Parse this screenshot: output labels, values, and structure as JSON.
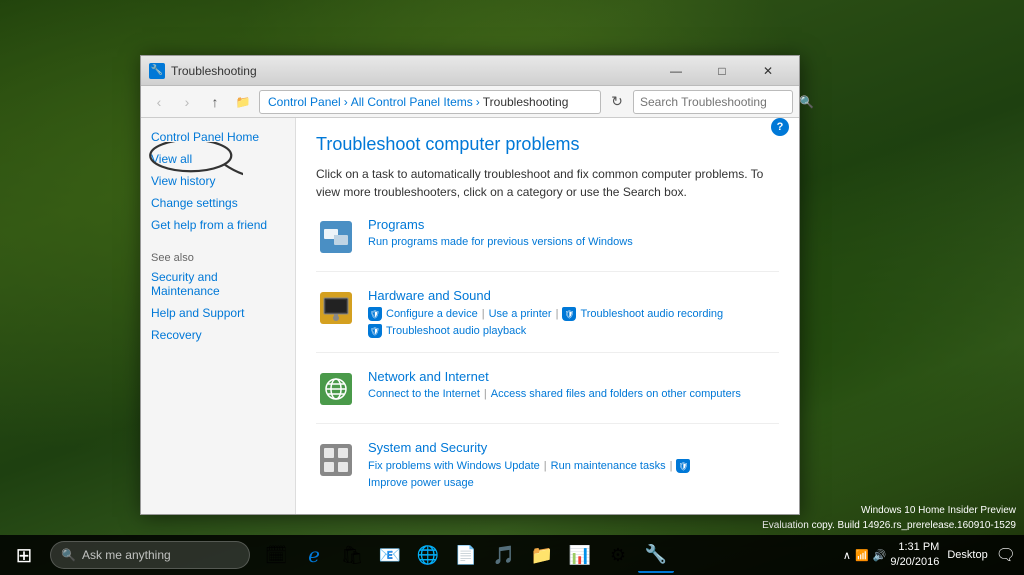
{
  "desktop": {
    "background": "forest"
  },
  "window": {
    "title": "Troubleshooting",
    "icon": "🔧",
    "controls": {
      "minimize": "—",
      "maximize": "□",
      "close": "✕"
    },
    "addressBar": {
      "back": "‹",
      "forward": "›",
      "up": "↑",
      "path": [
        {
          "label": "Control Panel",
          "href": true
        },
        {
          "label": "All Control Panel Items",
          "href": true
        },
        {
          "label": "Troubleshooting",
          "href": false
        }
      ],
      "search_placeholder": "Search Troubleshooting"
    },
    "sidebar": {
      "links": [
        {
          "label": "Control Panel Home",
          "id": "control-panel-home"
        },
        {
          "label": "View all",
          "id": "view-all"
        },
        {
          "label": "View history",
          "id": "view-history"
        },
        {
          "label": "Change settings",
          "id": "change-settings"
        },
        {
          "label": "Get help from a friend",
          "id": "get-help"
        }
      ],
      "see_also": {
        "title": "See also",
        "links": [
          {
            "label": "Security and Maintenance"
          },
          {
            "label": "Help and Support"
          },
          {
            "label": "Recovery"
          }
        ]
      }
    },
    "main": {
      "title": "Troubleshoot computer problems",
      "description": "Click on a task to automatically troubleshoot and fix common computer problems. To view more troubleshooters, click on a category or use the Search box.",
      "categories": [
        {
          "id": "programs",
          "title": "Programs",
          "links": [
            {
              "label": "Run programs made for previous versions of Windows",
              "shield": false
            }
          ]
        },
        {
          "id": "hardware",
          "title": "Hardware and Sound",
          "links": [
            {
              "label": "Configure a device",
              "shield": true
            },
            {
              "label": "Use a printer",
              "shield": false
            },
            {
              "label": "Troubleshoot audio recording",
              "shield": true
            },
            {
              "label": "Troubleshoot audio playback",
              "shield": true
            }
          ]
        },
        {
          "id": "network",
          "title": "Network and Internet",
          "links": [
            {
              "label": "Connect to the Internet",
              "shield": false
            },
            {
              "label": "Access shared files and folders on other computers",
              "shield": false
            }
          ]
        },
        {
          "id": "system",
          "title": "System and Security",
          "links": [
            {
              "label": "Fix problems with Windows Update",
              "shield": false
            },
            {
              "label": "Run maintenance tasks",
              "shield": false
            },
            {
              "label": "Improve power usage",
              "shield": true
            }
          ]
        }
      ]
    }
  },
  "taskbar": {
    "start_label": "⊞",
    "search_placeholder": "Ask me anything",
    "time": "1:31 PM",
    "date": "9/20/2016",
    "win_info_line1": "Windows 10 Home Insider Preview",
    "win_info_line2": "Evaluation copy. Build 14926.rs_prerelease.160910-1529",
    "apps": [
      "⊞",
      "🔍",
      "🗓",
      "🌐",
      "📁",
      "⚙"
    ],
    "desktop_label": "Desktop"
  }
}
